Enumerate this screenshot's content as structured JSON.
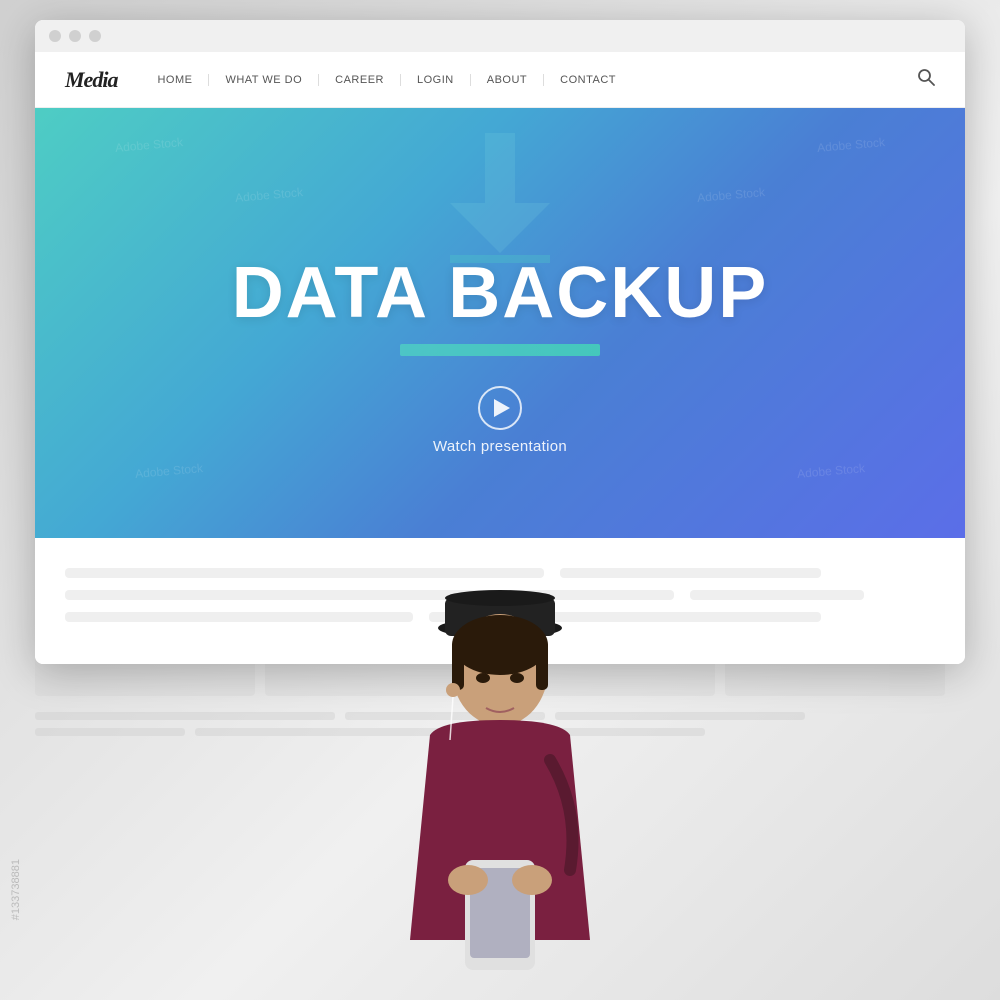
{
  "browser": {
    "dots": [
      "dot1",
      "dot2",
      "dot3"
    ]
  },
  "nav": {
    "logo": "Media",
    "links": [
      {
        "label": "HOME",
        "id": "home"
      },
      {
        "label": "WHAT WE DO",
        "id": "what-we-do"
      },
      {
        "label": "CAREER",
        "id": "career"
      },
      {
        "label": "LOGIN",
        "id": "login"
      },
      {
        "label": "ABOUT",
        "id": "about"
      },
      {
        "label": "CONTACT",
        "id": "contact"
      }
    ],
    "search_placeholder": "Search"
  },
  "hero": {
    "title": "DATA BACKUP",
    "watch_label": "Watch presentation",
    "gradient_start": "#4ecdc4",
    "gradient_end": "#5b6ee8"
  },
  "watermark": {
    "stock_id": "#133738881",
    "adobe_text": "Adobe Stock"
  },
  "content": {
    "blocks": [
      {
        "width": "60%"
      },
      {
        "width": "40%"
      },
      {
        "width": "75%"
      },
      {
        "width": "25%"
      }
    ]
  }
}
